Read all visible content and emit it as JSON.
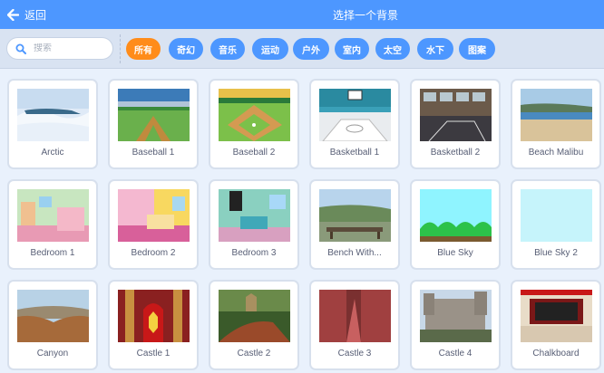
{
  "header": {
    "back_label": "返回",
    "title": "选择一个背景"
  },
  "search": {
    "placeholder": "搜索"
  },
  "tags": [
    {
      "label": "所有",
      "active": true
    },
    {
      "label": "奇幻",
      "active": false
    },
    {
      "label": "音乐",
      "active": false
    },
    {
      "label": "运动",
      "active": false
    },
    {
      "label": "户外",
      "active": false
    },
    {
      "label": "室内",
      "active": false
    },
    {
      "label": "太空",
      "active": false
    },
    {
      "label": "水下",
      "active": false
    },
    {
      "label": "图案",
      "active": false
    }
  ],
  "backdrops": [
    {
      "label": "Arctic",
      "thumb": "arctic"
    },
    {
      "label": "Baseball 1",
      "thumb": "baseball1"
    },
    {
      "label": "Baseball 2",
      "thumb": "baseball2"
    },
    {
      "label": "Basketball 1",
      "thumb": "basketball1"
    },
    {
      "label": "Basketball 2",
      "thumb": "basketball2"
    },
    {
      "label": "Beach Malibu",
      "thumb": "beach"
    },
    {
      "label": "Bedroom 1",
      "thumb": "bedroom1"
    },
    {
      "label": "Bedroom 2",
      "thumb": "bedroom2"
    },
    {
      "label": "Bedroom 3",
      "thumb": "bedroom3"
    },
    {
      "label": "Bench With...",
      "thumb": "bench"
    },
    {
      "label": "Blue Sky",
      "thumb": "bluesky"
    },
    {
      "label": "Blue Sky 2",
      "thumb": "bluesky2"
    },
    {
      "label": "Canyon",
      "thumb": "canyon"
    },
    {
      "label": "Castle 1",
      "thumb": "castle1"
    },
    {
      "label": "Castle 2",
      "thumb": "castle2"
    },
    {
      "label": "Castle 3",
      "thumb": "castle3"
    },
    {
      "label": "Castle 4",
      "thumb": "castle4"
    },
    {
      "label": "Chalkboard",
      "thumb": "chalkboard"
    }
  ],
  "colors": {
    "header_bg": "#4d97ff",
    "active_tag": "#ff8c1a",
    "tag": "#4d97ff",
    "page_bg": "#e9f1fc"
  }
}
